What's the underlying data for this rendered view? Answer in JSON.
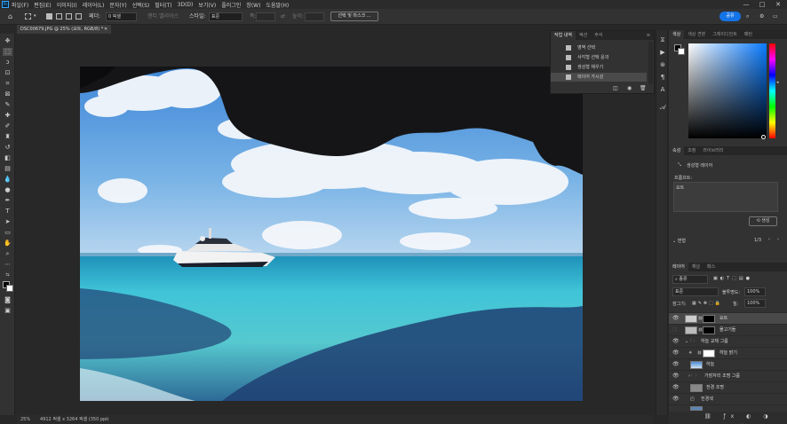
{
  "menubar": {
    "app_badge": "Ps",
    "items": [
      "파일(F)",
      "편집(E)",
      "이미지(I)",
      "레이어(L)",
      "문자(Y)",
      "선택(S)",
      "필터(T)",
      "3D(D)",
      "보기(V)",
      "플러그인",
      "창(W)",
      "도움말(H)"
    ],
    "minimize": "—",
    "maximize": "□",
    "close": "✕"
  },
  "options": {
    "feather_label": "페더:",
    "feather_value": "0 픽셀",
    "antialias_label": "앤티 앨리어스",
    "style_label": "스타일:",
    "style_value": "표준",
    "width_label": "폭:",
    "height_label": "높이:",
    "select_mask": "선택 및 마스크 ...",
    "share": "공유"
  },
  "document": {
    "tab_title": "DSC00679.JPG @ 25% (요트, RGB/8) *",
    "close": "✕"
  },
  "history": {
    "tabs": [
      "작업 내역",
      "액션",
      "주석"
    ],
    "items": [
      "영역 선택",
      "사각형 선택 윤곽",
      "생성형 채우기",
      "레이어 가시성"
    ],
    "selected_index": 3
  },
  "right_tabs_top": [
    "색상",
    "색상 견본",
    "그레이디언트",
    "패턴"
  ],
  "properties": {
    "tabs": [
      "속성",
      "조정",
      "라이브러리"
    ],
    "layer_type": "생성형 레이어",
    "prompt_label": "프롬프트:",
    "prompt_value": "요트",
    "generate_button": "생성",
    "variants_label": "변형",
    "variants_count": "1/3"
  },
  "layers_panel": {
    "tabs": [
      "레이어",
      "채널",
      "패스"
    ],
    "filter_kind": "종류",
    "blend_mode": "표준",
    "opacity_label": "불투명도:",
    "opacity_value": "100%",
    "lock_label": "잠그기:",
    "fill_label": "칠:",
    "fill_value": "100%",
    "layers": [
      {
        "name": "요트",
        "visible": true,
        "selected": true
      },
      {
        "name": "물고기들",
        "visible": false,
        "selected": false
      },
      {
        "name": "하늘 교체 그룹",
        "visible": true,
        "selected": false,
        "group": true
      },
      {
        "name": "하늘 밝기",
        "visible": true,
        "selected": false
      },
      {
        "name": "하늘",
        "visible": true,
        "selected": false
      },
      {
        "name": "가장자리 조명 그룹",
        "visible": true,
        "selected": false,
        "group": true
      },
      {
        "name": "전경 조명",
        "visible": true,
        "selected": false
      },
      {
        "name": "전경색",
        "visible": true,
        "selected": false
      }
    ]
  },
  "status": {
    "zoom": "25%",
    "doc_info": "4912 픽셀 x 3264 픽셀 (350 ppi)"
  },
  "colors": {
    "accent": "#1473e6",
    "panel": "#323232",
    "canvas_bg": "#282828"
  }
}
